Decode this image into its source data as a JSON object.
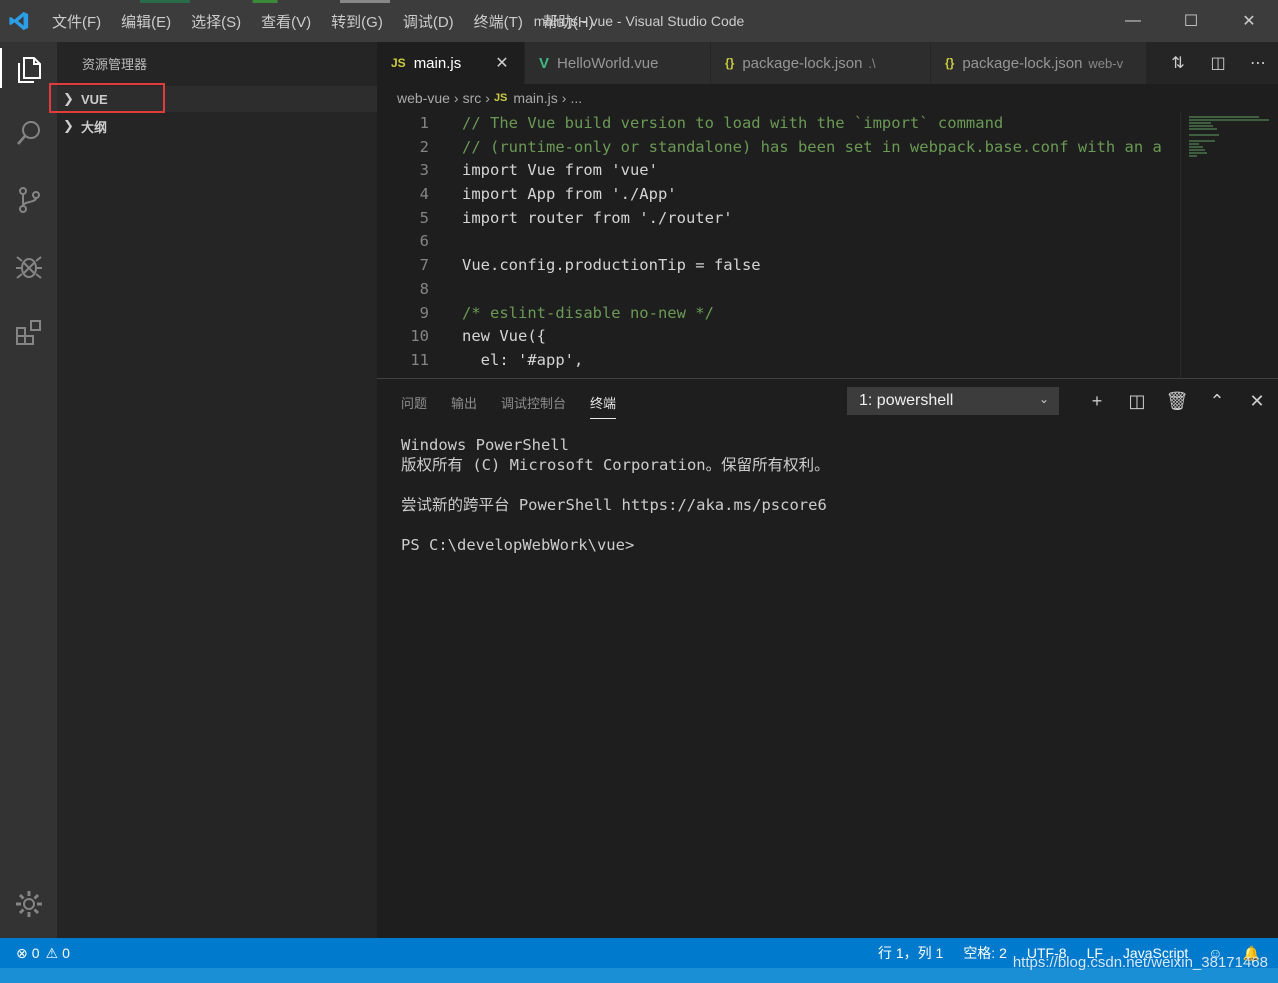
{
  "titlebar": {
    "menu": [
      "文件(F)",
      "编辑(E)",
      "选择(S)",
      "查看(V)",
      "转到(G)",
      "调试(D)",
      "终端(T)",
      "帮助(H)"
    ],
    "title": "main.js - vue - Visual Studio Code"
  },
  "activity_bar": {
    "icons": [
      "files-icon",
      "search-icon",
      "source-control-icon",
      "debug-icon",
      "extensions-icon",
      "settings-gear-icon"
    ]
  },
  "sidebar": {
    "title": "资源管理器",
    "sections": [
      "VUE",
      "大纲"
    ]
  },
  "tabs": [
    {
      "icon": "JS",
      "label": "main.js",
      "active": true
    },
    {
      "icon": "V",
      "label": "HelloWorld.vue"
    },
    {
      "icon": "{}",
      "label": "package-lock.json",
      "hint": ".\\"
    },
    {
      "icon": "{}",
      "label": "package-lock.json",
      "hint": "web-v"
    }
  ],
  "breadcrumb": [
    "web-vue",
    "src",
    "main.js",
    "..."
  ],
  "editor": {
    "line_numbers": [
      "1",
      "2",
      "3",
      "4",
      "5",
      "6",
      "7",
      "8",
      "9",
      "10",
      "11"
    ],
    "lines": [
      "// The Vue build version to load with the `import` command",
      "// (runtime-only or standalone) has been set in webpack.base.conf with an a",
      "import Vue from 'vue'",
      "import App from './App'",
      "import router from './router'",
      "",
      "Vue.config.productionTip = false",
      "",
      "/* eslint-disable no-new */",
      "new Vue({",
      "  el: '#app',"
    ]
  },
  "panel": {
    "tabs": [
      "问题",
      "输出",
      "调试控制台",
      "终端"
    ],
    "active_tab": "终端",
    "terminal_select": "1: powershell",
    "terminal_lines": [
      "Windows PowerShell",
      "版权所有 (C) Microsoft Corporation。保留所有权利。",
      "",
      "尝试新的跨平台 PowerShell https://aka.ms/pscore6",
      "",
      "PS C:\\developWebWork\\vue>"
    ]
  },
  "statusbar": {
    "errors": "0",
    "warnings": "0",
    "position": "行 1，列 1",
    "spaces": "空格: 2",
    "encoding": "UTF-8",
    "eol": "LF",
    "language": "JavaScript"
  },
  "watermark": "https://blog.csdn.net/weixin_38171468",
  "colors": {
    "statusbar": "#007acc",
    "activity": "#333333",
    "sidebar": "#252526",
    "editor": "#1e1e1e"
  }
}
